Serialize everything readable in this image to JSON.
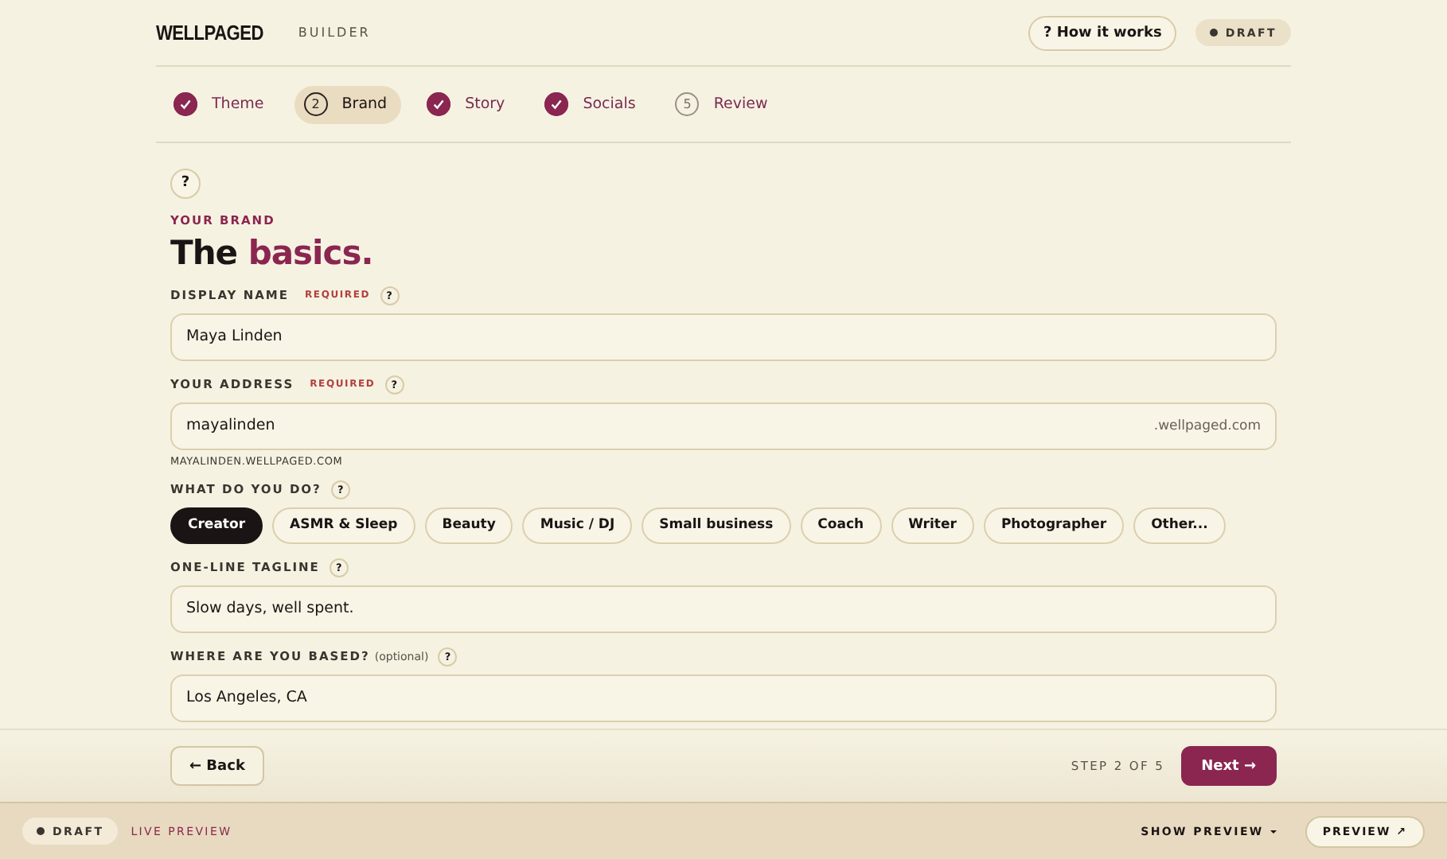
{
  "header": {
    "logo": "WELLPAGED",
    "subtitle": "BUILDER",
    "help_button": "? How it works",
    "status_badge": "DRAFT"
  },
  "steps": [
    {
      "label": "Theme",
      "done": true,
      "selected": false
    },
    {
      "label": "Brand",
      "number": "2",
      "done": false,
      "selected": true
    },
    {
      "label": "Story",
      "done": true,
      "selected": false
    },
    {
      "label": "Socials",
      "done": true,
      "selected": false
    },
    {
      "label": "Review",
      "number": "5",
      "done": false,
      "selected": false
    }
  ],
  "help_icon": "?",
  "eyebrow": "YOUR BRAND",
  "heading": {
    "plain": "The",
    "accent": "basics."
  },
  "fields": [
    {
      "kind": "text",
      "label": "DISPLAY NAME",
      "required": "REQUIRED",
      "value": "Maya Linden"
    },
    {
      "kind": "address",
      "label": "YOUR ADDRESS",
      "required": "REQUIRED",
      "value": "mayalinden",
      "suffix": ".wellpaged.com",
      "hint": "MAYALINDEN.WELLPAGED.COM"
    },
    {
      "kind": "chips",
      "label": "WHAT DO YOU DO?",
      "options": [
        {
          "label": "Creator",
          "selected": true
        },
        {
          "label": "ASMR & Sleep",
          "selected": false
        },
        {
          "label": "Beauty",
          "selected": false
        },
        {
          "label": "Music / DJ",
          "selected": false
        },
        {
          "label": "Small business",
          "selected": false
        },
        {
          "label": "Coach",
          "selected": false
        },
        {
          "label": "Writer",
          "selected": false
        },
        {
          "label": "Photographer",
          "selected": false
        },
        {
          "label": "Other...",
          "selected": false
        }
      ]
    },
    {
      "kind": "text",
      "label": "ONE-LINE TAGLINE",
      "value": "Slow days, well spent."
    },
    {
      "kind": "text",
      "label": "WHERE ARE YOU BASED?",
      "optional": "(optional)",
      "value": "Los Angeles, CA"
    }
  ],
  "nav": {
    "back": "← Back",
    "step_text": "STEP 2 OF 5",
    "next": "Next →"
  },
  "bottom_bar": {
    "badge": "DRAFT",
    "live": "LIVE PREVIEW",
    "show_preview": "SHOW PREVIEW",
    "preview_button": "PREVIEW ↗"
  }
}
